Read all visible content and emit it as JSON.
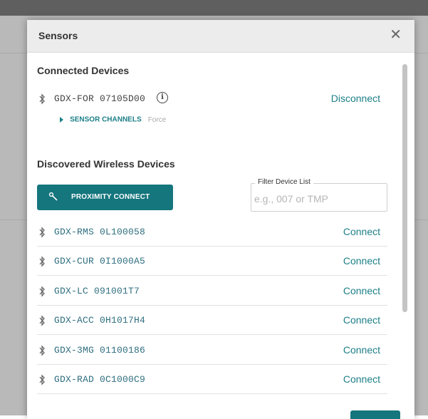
{
  "colors": {
    "accent": "#15767d",
    "link": "#1c7f87",
    "device_text": "#2f6f80"
  },
  "modal": {
    "title": "Sensors",
    "close_icon": "close-icon"
  },
  "connected": {
    "heading": "Connected Devices",
    "device": {
      "name": "GDX-FOR 07105D00",
      "icon": "bluetooth-icon",
      "info_icon": "info-icon",
      "info_glyph": "i",
      "action": "Disconnect"
    },
    "sensor_channels": {
      "label": "SENSOR CHANNELS",
      "value": "Force"
    }
  },
  "discovered": {
    "heading": "Discovered Wireless Devices",
    "proximity_button": {
      "label": "PROXIMITY CONNECT",
      "icon": "proximity-icon"
    },
    "filter": {
      "label": "Filter Device List",
      "placeholder": "e.g., 007 or TMP",
      "value": ""
    },
    "devices": [
      {
        "name": "GDX-RMS 0L100058",
        "action": "Connect"
      },
      {
        "name": "GDX-CUR 0I1000A5",
        "action": "Connect"
      },
      {
        "name": "GDX-LC 091001T7",
        "action": "Connect"
      },
      {
        "name": "GDX-ACC 0H1017H4",
        "action": "Connect"
      },
      {
        "name": "GDX-3MG 01100186",
        "action": "Connect"
      },
      {
        "name": "GDX-RAD 0C1000C9",
        "action": "Connect"
      }
    ]
  }
}
